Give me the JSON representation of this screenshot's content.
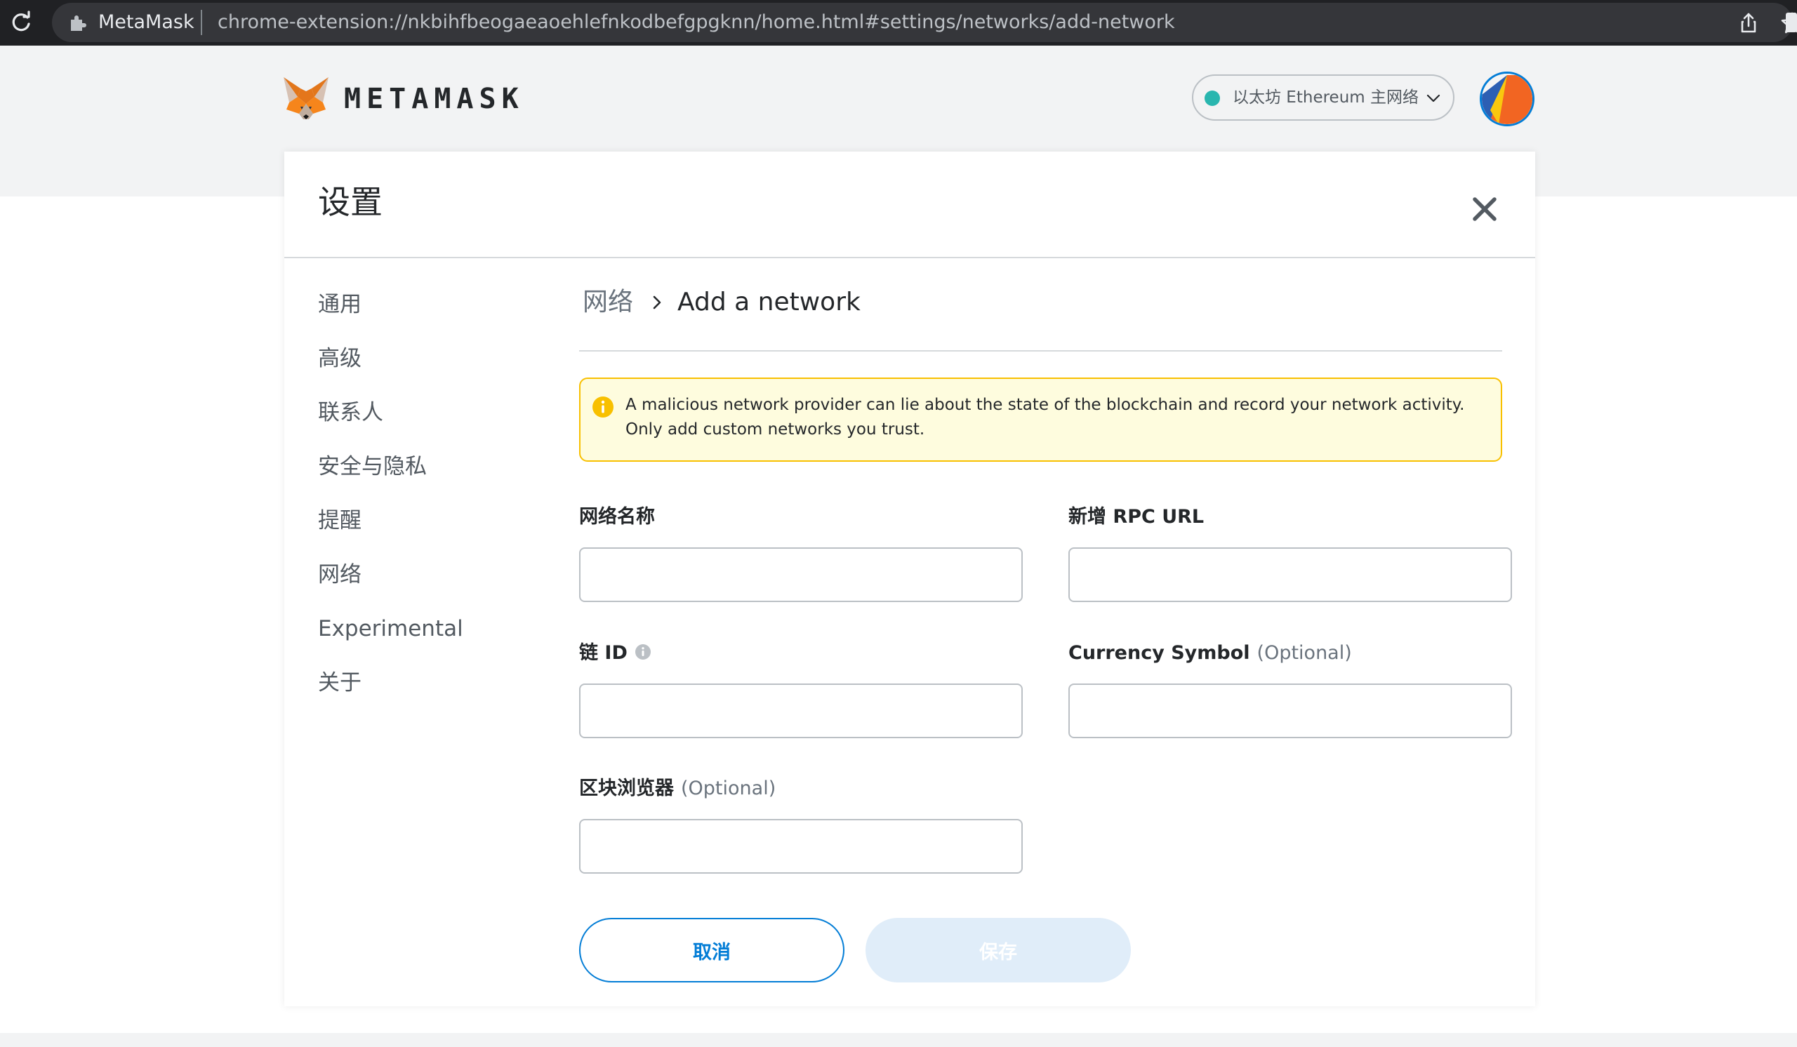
{
  "browser": {
    "site_name": "MetaMask",
    "url": "chrome-extension://nkbihfbeogaeaoehlefnkodbefgpgknn/home.html#settings/networks/add-network"
  },
  "app": {
    "wordmark": "METAMASK",
    "network_name": "以太坊 Ethereum 主网络",
    "network_dot_color": "#29b6af",
    "accent_color": "#037dd6"
  },
  "settings": {
    "title": "设置",
    "sidebar": [
      {
        "label": "通用"
      },
      {
        "label": "高级"
      },
      {
        "label": "联系人"
      },
      {
        "label": "安全与隐私"
      },
      {
        "label": "提醒"
      },
      {
        "label": "网络"
      },
      {
        "label": "Experimental"
      },
      {
        "label": "关于"
      }
    ],
    "breadcrumb": {
      "root": "网络",
      "current": "Add a network"
    },
    "warning": "A malicious network provider can lie about the state of the blockchain and record your network activity. Only add custom networks you trust.",
    "fields": {
      "network_name": {
        "label": "网络名称",
        "value": ""
      },
      "rpc_url": {
        "label": "新增 RPC URL",
        "value": ""
      },
      "chain_id": {
        "label": "链 ID",
        "value": ""
      },
      "currency_symbol": {
        "label": "Currency Symbol",
        "optional": "(Optional)",
        "value": ""
      },
      "block_explorer": {
        "label": "区块浏览器",
        "optional": "(Optional)",
        "value": ""
      }
    },
    "buttons": {
      "cancel": "取消",
      "save": "保存"
    }
  }
}
